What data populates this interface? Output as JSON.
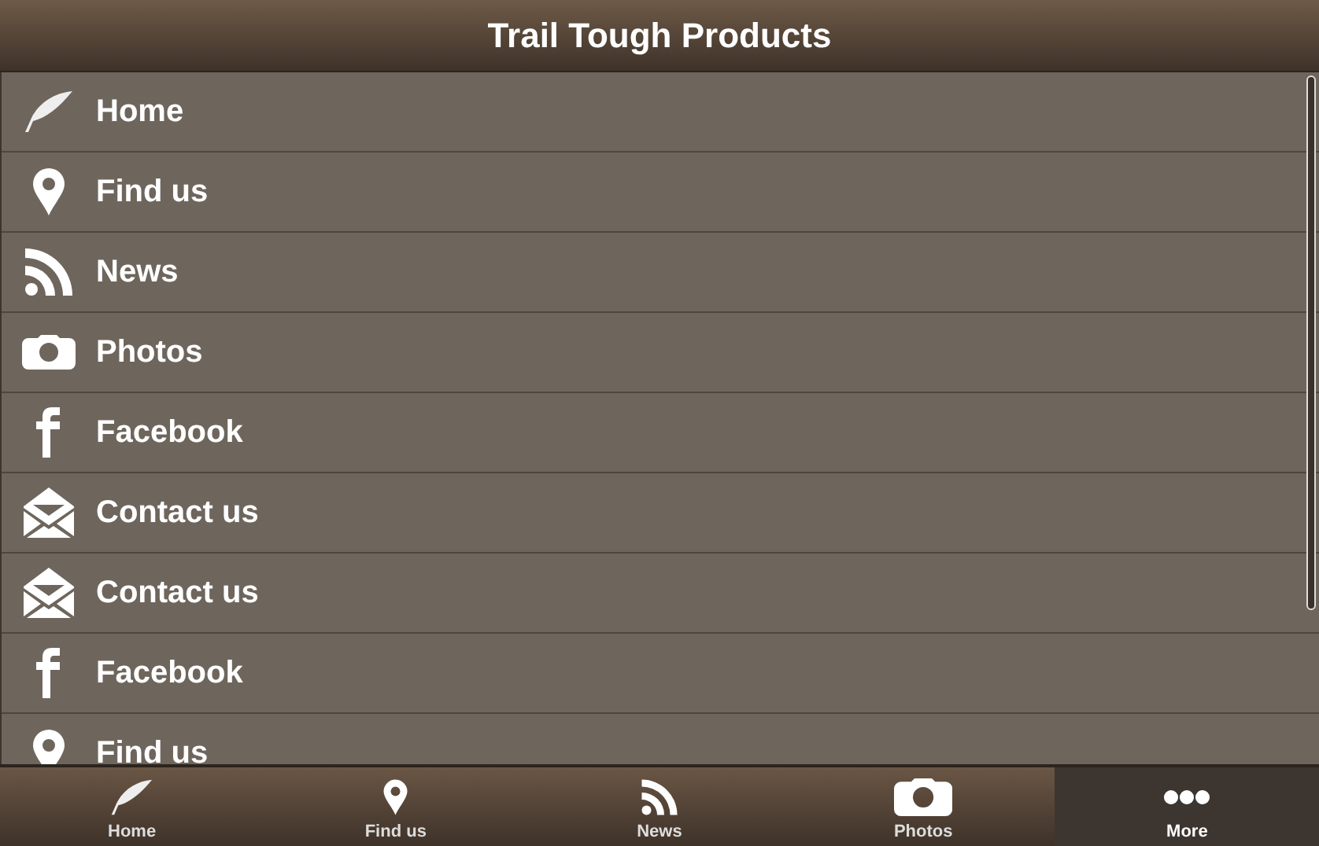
{
  "header": {
    "title": "Trail Tough Products"
  },
  "menu": [
    {
      "label": "Home",
      "kind": "feather"
    },
    {
      "label": "Find us",
      "kind": "pin"
    },
    {
      "label": "News",
      "kind": "rss"
    },
    {
      "label": "Photos",
      "kind": "camera"
    },
    {
      "label": "Facebook",
      "kind": "facebook"
    },
    {
      "label": "Contact us",
      "kind": "mail"
    },
    {
      "label": "Contact us",
      "kind": "mail"
    },
    {
      "label": "Facebook",
      "kind": "facebook"
    },
    {
      "label": "Find us",
      "kind": "pin"
    }
  ],
  "tabs": [
    {
      "label": "Home",
      "kind": "feather",
      "selected": false
    },
    {
      "label": "Find us",
      "kind": "pin",
      "selected": false
    },
    {
      "label": "News",
      "kind": "rss",
      "selected": false
    },
    {
      "label": "Photos",
      "kind": "camera",
      "selected": false
    },
    {
      "label": "More",
      "kind": "dots",
      "selected": true
    }
  ]
}
